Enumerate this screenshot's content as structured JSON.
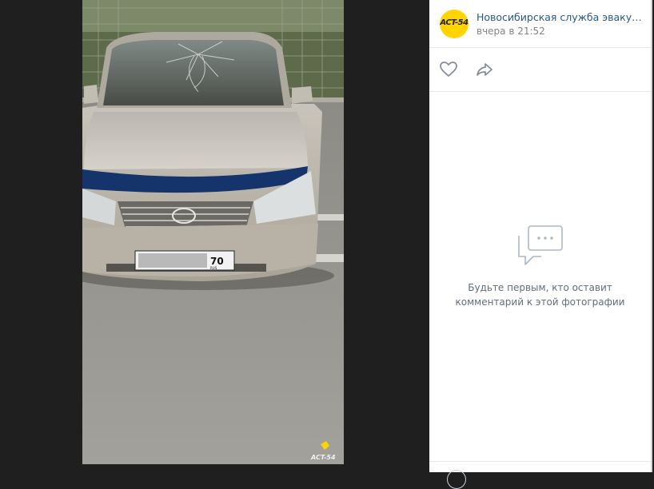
{
  "post": {
    "owner_name": "Новосибирская служба эвакуации...",
    "date": "вчера в 21:52",
    "avatar_text": "ACT-54"
  },
  "photo": {
    "plate_region": "70",
    "plate_country": "RUS",
    "watermark": "ACT-54"
  },
  "actions": {
    "like_icon": "heart-icon",
    "share_icon": "share-icon"
  },
  "comments": {
    "empty_line1": "Будьте первым, кто оставит",
    "empty_line2": "комментарий к этой фотографии",
    "empty_icon": "comment-bubble-icon"
  },
  "colors": {
    "link": "#2a5885",
    "accent_yellow": "#ffd400",
    "background_dark": "#1f1f1f"
  }
}
